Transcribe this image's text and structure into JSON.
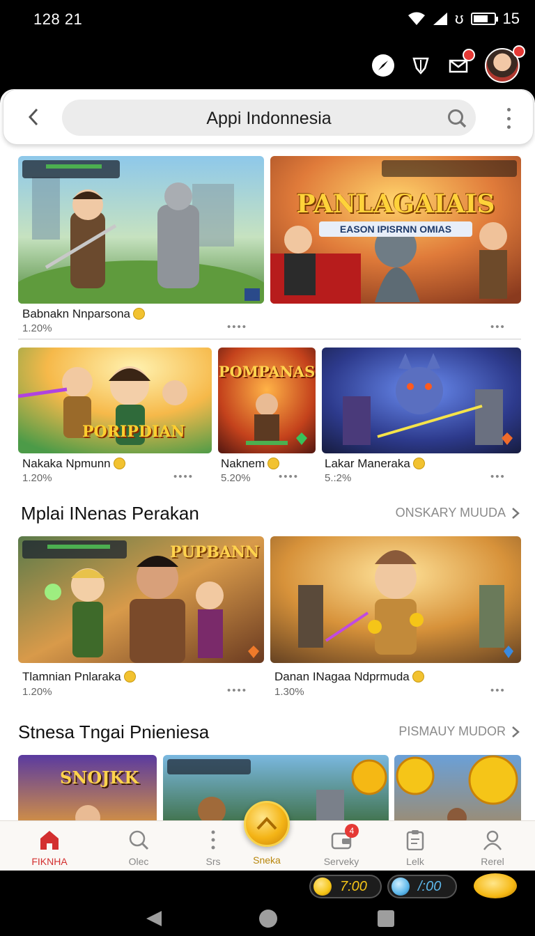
{
  "status_bar": {
    "time": "128 21",
    "signal_text": "ʊ",
    "battery_percent": "15",
    "battery_level": 0.7
  },
  "header": {
    "search_text": "Appi Indonnesia"
  },
  "row1": [
    {
      "title": "Babnakn Nnparsona",
      "meta": "1.20%"
    },
    {
      "title": "",
      "meta": "",
      "banner": "PANLAGAIAIS",
      "banner_sub": "EASON IPISRNN OMIAS"
    }
  ],
  "row2": [
    {
      "title": "Nakaka Npmunn",
      "meta": "1.20%",
      "banner": "PORIPDIAN"
    },
    {
      "title": "Naknem",
      "meta": "5.20%",
      "banner": "POMPANAS"
    },
    {
      "title": "Lakar Maneraka",
      "meta": "5.:2%"
    }
  ],
  "section1": {
    "title": "Mplai INenas Perakan",
    "link": "ONSKARY MUUDA",
    "cards": [
      {
        "title": "Tlamnian Pnlaraka",
        "meta": "1.20%",
        "banner": "PUPBANN"
      },
      {
        "title": "Danan INagaa Ndprmuda",
        "meta": "1.30%"
      }
    ]
  },
  "section2": {
    "title": "Stnesa Tngai Pnieniesa",
    "link": "PISMAUY MUDOR",
    "banners": [
      "SNOJKK",
      "",
      "",
      ""
    ]
  },
  "bottom_nav": [
    {
      "label": "FIKNHA",
      "icon": "home-icon"
    },
    {
      "label": "Olec",
      "icon": "search-icon"
    },
    {
      "label": "Srs",
      "icon": "more-vertical-icon"
    },
    {
      "label": "Sneka",
      "icon": "coin-icon"
    },
    {
      "label": "Serveky",
      "icon": "wallet-icon",
      "badge": "4"
    },
    {
      "label": "Lelk",
      "icon": "clipboard-icon"
    },
    {
      "label": "Rerel",
      "icon": "profile-icon"
    }
  ],
  "currency": [
    {
      "value": "7:00",
      "color": "#f5c518"
    },
    {
      "value": "/:00",
      "color": "#5db7ea"
    }
  ],
  "colors": {
    "accent": "#d32f2f",
    "gold": "#f4b416"
  }
}
